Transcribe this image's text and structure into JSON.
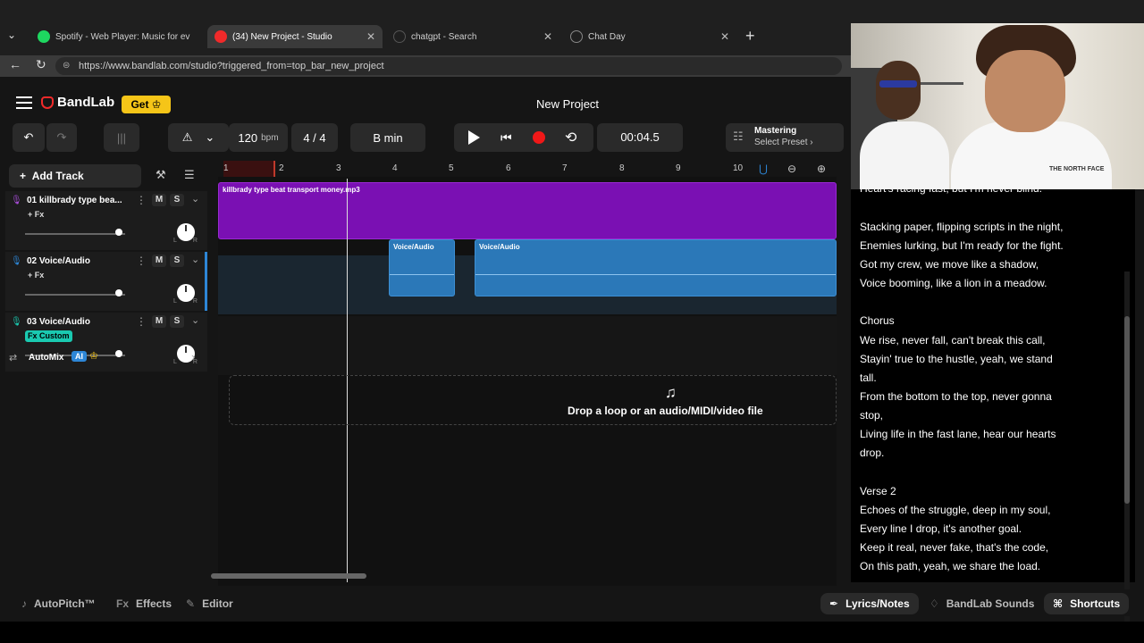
{
  "browser": {
    "tabs": [
      {
        "label": "Spotify - Web Player: Music for ev",
        "icon_color": "#1ed760"
      },
      {
        "label": "(34) New Project - Studio",
        "icon_color": "#f02a2a"
      },
      {
        "label": "chatgpt - Search",
        "icon_color": "#555555"
      },
      {
        "label": "Chat Day",
        "icon_color": "#888888"
      }
    ],
    "url": "https://www.bandlab.com/studio?triggered_from=top_bar_new_project"
  },
  "app": {
    "brand": "BandLab",
    "get_label": "Get",
    "project_title": "New Project",
    "tempo": "120",
    "tempo_unit": "bpm",
    "time_signature": "4 / 4",
    "key": "B min",
    "time_display": "00:04.5",
    "mastering": {
      "title": "Mastering",
      "subtitle": "Select Preset ›"
    },
    "add_track_label": "Add Track",
    "accent": "#2d86d6",
    "record_color": "#f01818"
  },
  "tracks": [
    {
      "name": "01  killbrady type bea...",
      "fx": "+ Fx",
      "volume": 0.95
    },
    {
      "name": "02  Voice/Audio",
      "fx": "+ Fx",
      "volume": 0.95
    },
    {
      "name": "03  Voice/Audio",
      "fx": "Fx Custom",
      "volume": 0.95
    }
  ],
  "automix": {
    "label": "AutoMix",
    "badge": "AI"
  },
  "ruler": {
    "marks": [
      "1",
      "2",
      "3",
      "4",
      "5",
      "6",
      "7",
      "8",
      "9",
      "10"
    ]
  },
  "clips": {
    "beat": "killbrady type beat transport money.mp3",
    "voice_a": "Voice/Audio",
    "voice_b": "Voice/Audio"
  },
  "drop_text": "Drop a loop or an audio/MIDI/video file",
  "lyrics": [
    "Heart's racing fast, but I'm never blind.",
    "",
    "Stacking paper, flipping scripts in the night,",
    "Enemies lurking, but I'm ready for the fight.",
    "Got my crew, we move like a shadow,",
    "Voice booming, like a lion in a meadow.",
    "",
    "Chorus",
    "We rise, never fall, can't break this call,",
    "Stayin' true to the hustle, yeah, we stand",
    "tall.",
    "From the bottom to the top, never gonna",
    "stop,",
    "Living life in the fast lane, hear our hearts",
    "drop.",
    "",
    "Verse 2",
    "Echoes of the struggle, deep in my soul,",
    "Every line I drop, it's another goal.",
    "Keep it real, never fake, that's the code,",
    "On this path, yeah, we share the load."
  ],
  "bottom": {
    "autopitch": "AutoPitch™",
    "effects": "Effects",
    "editor": "Editor",
    "lyrics_notes": "Lyrics/Notes",
    "sounds": "BandLab Sounds",
    "shortcuts": "Shortcuts"
  },
  "webcam": {
    "shirt_text": "THE NORTH FACE"
  }
}
